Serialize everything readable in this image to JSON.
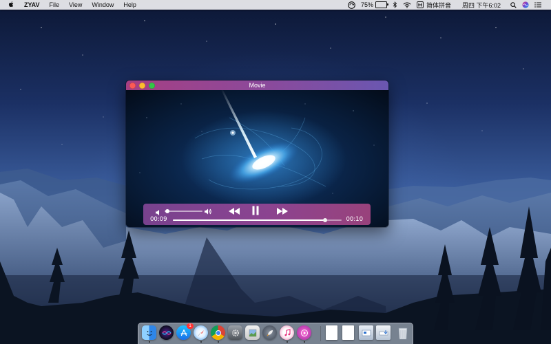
{
  "menubar": {
    "apple_icon": "apple-logo-icon",
    "app_name": "ZYAV",
    "menus": [
      "File",
      "View",
      "Window",
      "Help"
    ],
    "battery_percent": "75%",
    "input_method": "简体拼音",
    "clock": "周四 下午6:02"
  },
  "player": {
    "title": "Movie",
    "current_time": "00:09",
    "duration": "00:10",
    "progress": 0.9,
    "volume": 0.0
  },
  "dock": {
    "items": [
      {
        "name": "finder",
        "icon": "finder-icon",
        "running": true
      },
      {
        "name": "siri",
        "icon": "siri-icon",
        "running": false
      },
      {
        "name": "app-store",
        "icon": "app-store-icon",
        "running": false,
        "badge": "1"
      },
      {
        "name": "safari",
        "icon": "safari-icon",
        "running": true
      },
      {
        "name": "chrome",
        "icon": "chrome-icon",
        "running": true
      },
      {
        "name": "system-preferences",
        "icon": "gear-icon",
        "running": false
      },
      {
        "name": "preview",
        "icon": "preview-icon",
        "running": false
      },
      {
        "name": "launchpad",
        "icon": "rocket-icon",
        "running": false
      },
      {
        "name": "itunes",
        "icon": "music-icon",
        "running": true
      },
      {
        "name": "zyav-player",
        "icon": "player-app-icon",
        "running": true
      }
    ],
    "stacks": [
      "document-icon",
      "document-icon",
      "folder-stack-icon",
      "download-stack-icon"
    ],
    "trash_icon": "trash-icon"
  },
  "colors": {
    "titlebar_start": "#a63f83",
    "titlebar_end": "#6a57b1",
    "controls": "#8a4a9c"
  }
}
